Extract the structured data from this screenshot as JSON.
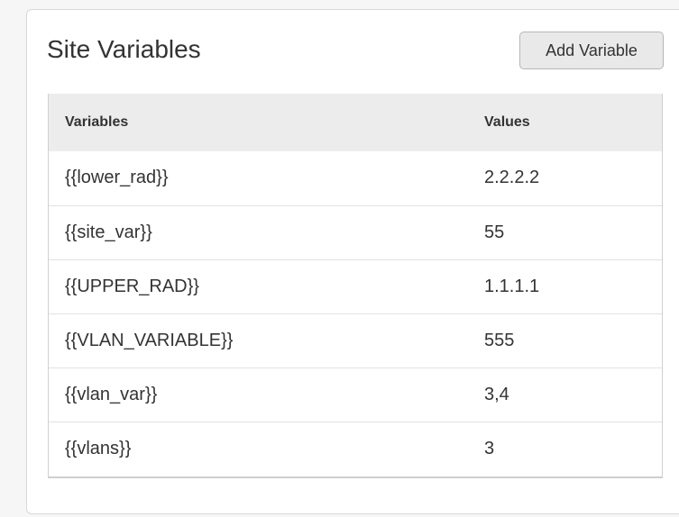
{
  "panel": {
    "title": "Site Variables",
    "add_button_label": "Add Variable"
  },
  "table": {
    "headers": [
      "Variables",
      "Values"
    ],
    "rows": [
      {
        "variable": "{{lower_rad}}",
        "value": "2.2.2.2"
      },
      {
        "variable": "{{site_var}}",
        "value": "55"
      },
      {
        "variable": "{{UPPER_RAD}}",
        "value": "1.1.1.1"
      },
      {
        "variable": "{{VLAN_VARIABLE}}",
        "value": "555"
      },
      {
        "variable": "{{vlan_var}}",
        "value": "3,4"
      },
      {
        "variable": "{{vlans}}",
        "value": "3"
      }
    ]
  }
}
